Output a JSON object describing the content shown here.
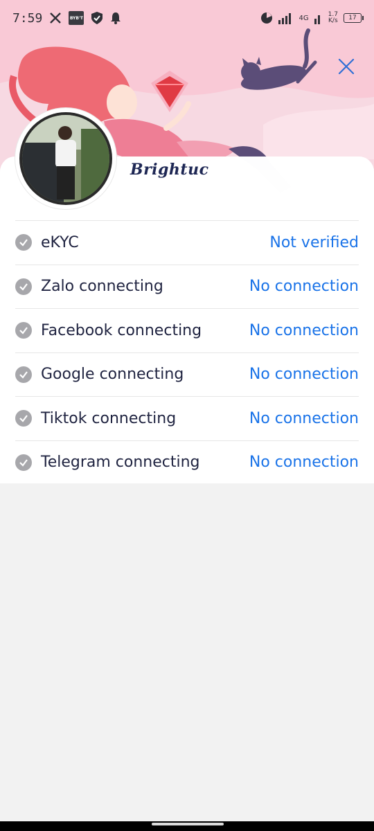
{
  "status_bar": {
    "time": "7:59",
    "bybit_label": "BYB'T",
    "network_type": "4G",
    "net_speed_value": "1.7",
    "net_speed_unit": "K/s",
    "battery_level": "17"
  },
  "profile": {
    "username": "Brightuc"
  },
  "connections": [
    {
      "label": "eKYC",
      "status": "Not verified"
    },
    {
      "label": "Zalo connecting",
      "status": "No connection"
    },
    {
      "label": "Facebook connecting",
      "status": "No connection"
    },
    {
      "label": "Google connecting",
      "status": "No connection"
    },
    {
      "label": "Tiktok connecting",
      "status": "No connection"
    },
    {
      "label": "Telegram connecting",
      "status": "No connection"
    }
  ],
  "colors": {
    "banner": "#f9c9d6",
    "accent_link": "#1a73e8",
    "text_primary": "#1f2340",
    "check_icon": "#a7a7ab"
  }
}
